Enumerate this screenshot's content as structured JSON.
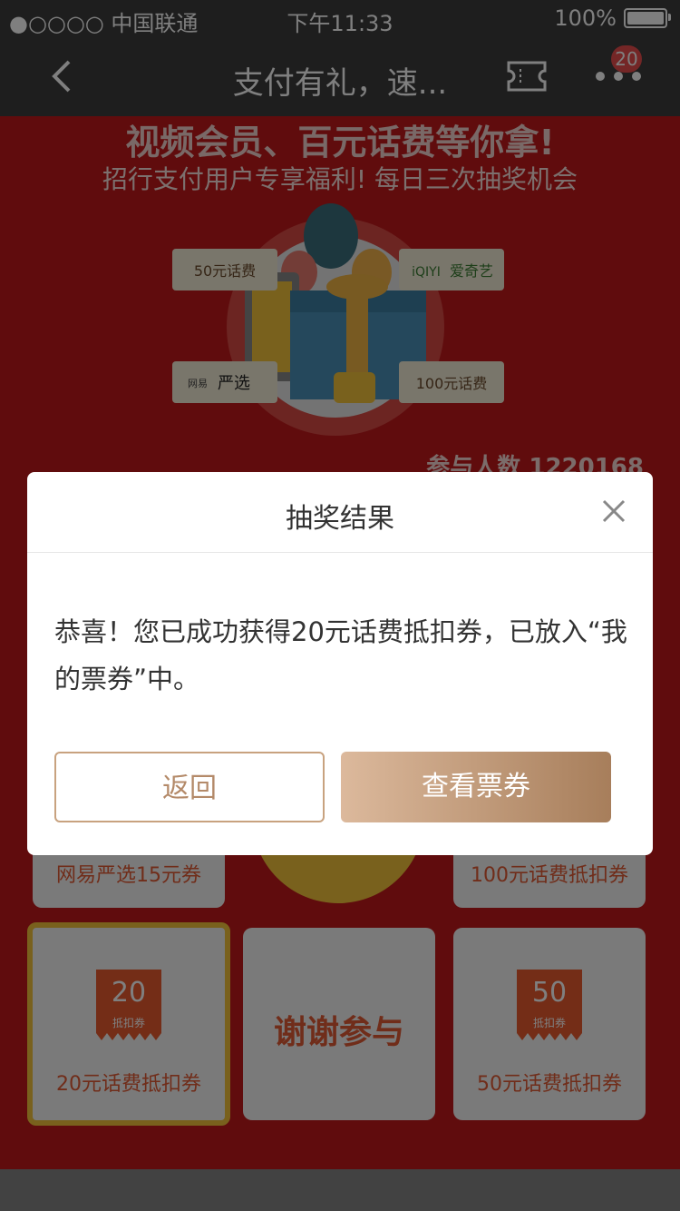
{
  "status_bar": {
    "carrier": "●○○○○ 中国联通",
    "time": "下午11:33",
    "battery": "100%",
    "battery_level": 1.0
  },
  "nav": {
    "title": "支付有礼，速...",
    "more_badge": "20"
  },
  "banner": {
    "title": "视频会员、百元话费等你拿!",
    "subtitle": "招行支付用户专享福利! 每日三次抽奖机会",
    "prizes": [
      "50元话费",
      "爱奇艺",
      "严选",
      "100元话费"
    ],
    "iqiyi_logo": "iQIYI",
    "wangyi_logo": "网易",
    "participants": "参与人数 1220168"
  },
  "grid": {
    "cards": [
      {
        "label": "网易严选15元券"
      },
      {
        "label": "100元话费抵扣券"
      },
      {
        "label": "20元话费抵扣券",
        "amount": "20",
        "sub": "抵扣券"
      },
      {
        "label": "谢谢参与"
      },
      {
        "label": "50元话费抵扣券",
        "amount": "50",
        "sub": "抵扣券"
      }
    ]
  },
  "modal": {
    "title": "抽奖结果",
    "message": "恭喜！您已成功获得20元话费抵扣券，已放入“我的票券”中。",
    "back_label": "返回",
    "view_label": "查看票券"
  },
  "colors": {
    "background_red": "#c0191b",
    "accent_gold": "#b48a69",
    "nav_bg": "#3d3d3d"
  }
}
